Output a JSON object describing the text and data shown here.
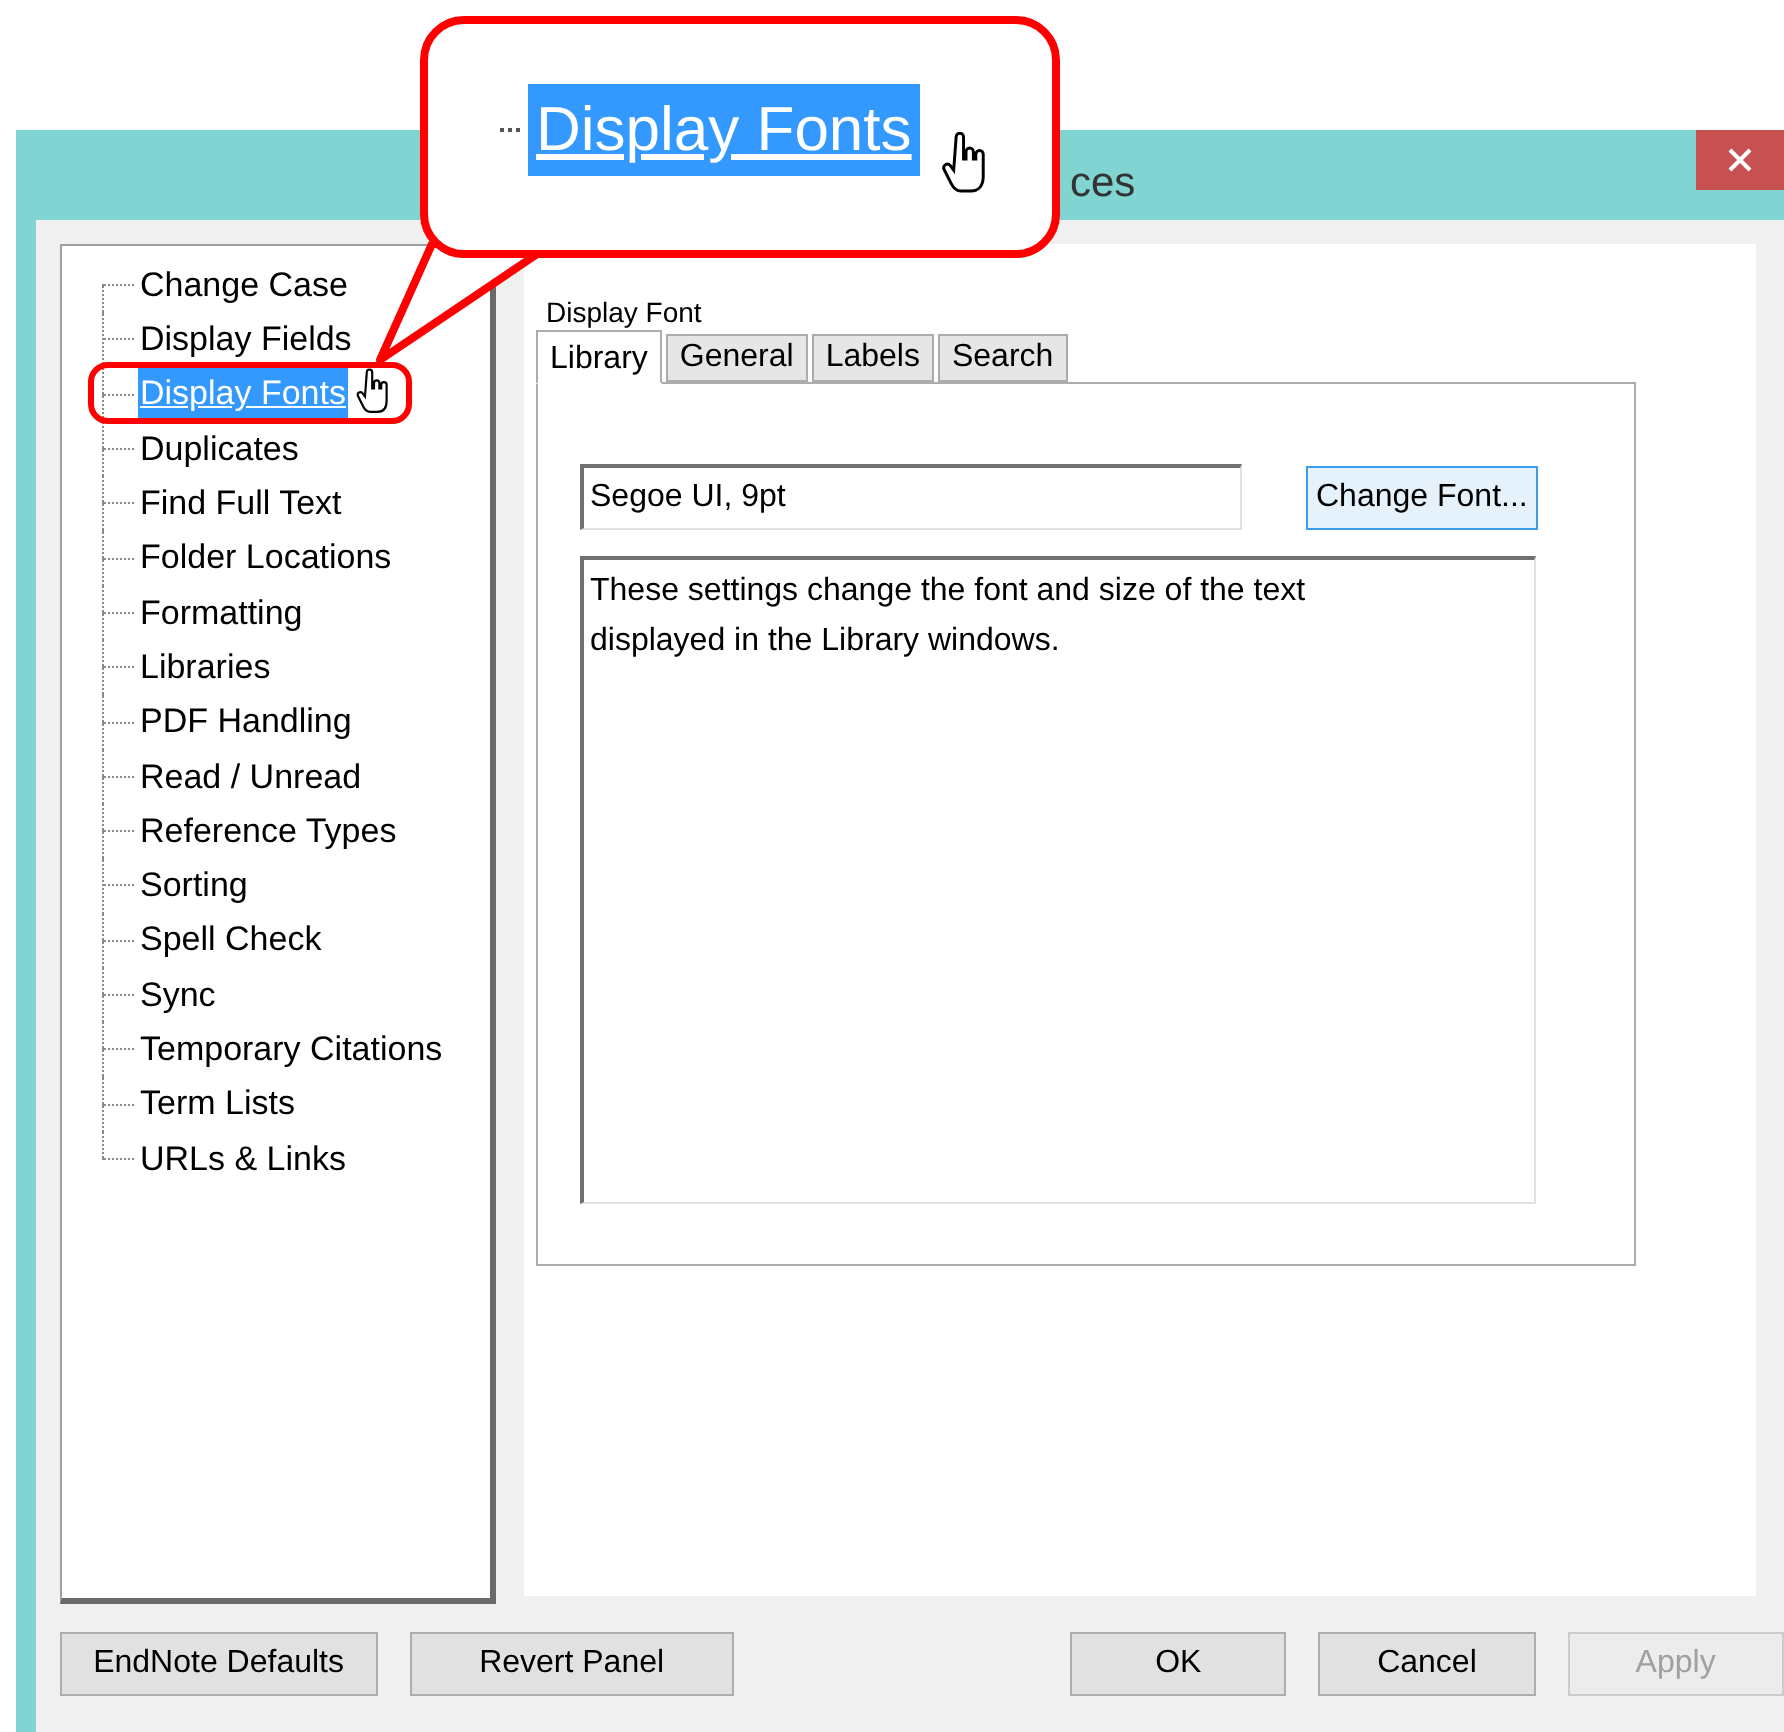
{
  "callout": {
    "label": "Display Fonts"
  },
  "window": {
    "title": "ces"
  },
  "tree": {
    "items": [
      {
        "label": "Change Case",
        "selected": false
      },
      {
        "label": "Display Fields",
        "selected": false
      },
      {
        "label": "Display Fonts",
        "selected": true
      },
      {
        "label": "Duplicates",
        "selected": false
      },
      {
        "label": "Find Full Text",
        "selected": false
      },
      {
        "label": "Folder Locations",
        "selected": false
      },
      {
        "label": "Formatting",
        "selected": false
      },
      {
        "label": "Libraries",
        "selected": false
      },
      {
        "label": "PDF Handling",
        "selected": false
      },
      {
        "label": "Read / Unread",
        "selected": false
      },
      {
        "label": "Reference Types",
        "selected": false
      },
      {
        "label": "Sorting",
        "selected": false
      },
      {
        "label": "Spell Check",
        "selected": false
      },
      {
        "label": "Sync",
        "selected": false
      },
      {
        "label": "Temporary Citations",
        "selected": false
      },
      {
        "label": "Term Lists",
        "selected": false
      },
      {
        "label": "URLs & Links",
        "selected": false
      }
    ]
  },
  "panel": {
    "heading": "Display Font",
    "tabs": [
      {
        "label": "Library",
        "selected": true
      },
      {
        "label": "General",
        "selected": false
      },
      {
        "label": "Labels",
        "selected": false
      },
      {
        "label": "Search",
        "selected": false
      }
    ],
    "font_field": {
      "value": "Segoe UI, 9pt"
    },
    "change_button": "Change Font...",
    "description": "These settings change the font and size of the text displayed in the Library windows."
  },
  "buttons": [
    {
      "label": "EndNote Defaults",
      "disabled": false
    },
    {
      "label": "Revert Panel",
      "disabled": false
    },
    {
      "label": "OK",
      "disabled": false
    },
    {
      "label": "Cancel",
      "disabled": false
    },
    {
      "label": "Apply",
      "disabled": true
    }
  ]
}
